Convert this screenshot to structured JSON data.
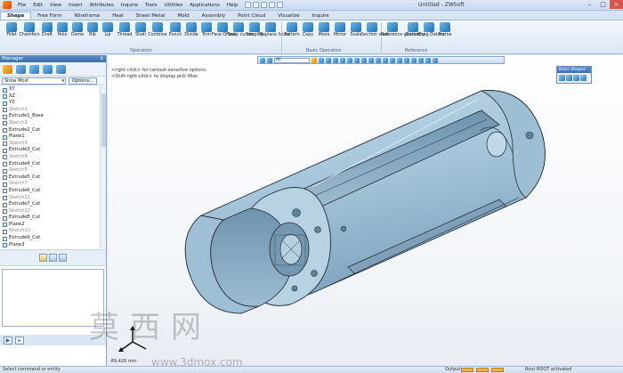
{
  "window": {
    "title": "Untitled - ZWSoft",
    "controls": {
      "minimize": "–",
      "maximize": "□",
      "close": "×"
    }
  },
  "menu": [
    "File",
    "Edit",
    "View",
    "Insert",
    "Attributes",
    "Inquire",
    "Tools",
    "Utilities",
    "Applications",
    "Help"
  ],
  "ribbon": {
    "tabs": [
      "Shape",
      "Free Form",
      "Wireframe",
      "Heal",
      "Sheet Metal",
      "Mold",
      "Assembly",
      "Point Cloud",
      "Visualize",
      "Inquire"
    ],
    "active_tab": "Shape",
    "buttons": [
      "Fillet",
      "Chamfers",
      "Draft",
      "Hole",
      "Dome",
      "Rib",
      "Lip",
      "Thread",
      "Shell",
      "Combine",
      "Punch",
      "Divide",
      "Trim",
      "Face Offset",
      "Snap curves",
      "Simplify",
      "Replace faces",
      "Pattern",
      "Copy",
      "Move",
      "Mirror",
      "Scale",
      "Section view",
      "Reference geometry",
      "Datum",
      "Drag Datum",
      "Frame"
    ],
    "groups": [
      "Operation",
      "Basic Operation",
      "Reference"
    ]
  },
  "manager": {
    "title": "Manager",
    "pin": "x",
    "filter": "Show Most",
    "options_label": "Options...",
    "tree": [
      {
        "label": "XY",
        "kind": "plane"
      },
      {
        "label": "XZ",
        "kind": "plane"
      },
      {
        "label": "YZ",
        "kind": "plane"
      },
      {
        "label": "Sketch1",
        "kind": "sketch"
      },
      {
        "label": "Extrude1_Base",
        "kind": "feature"
      },
      {
        "label": "Sketch2",
        "kind": "sketch"
      },
      {
        "label": "Extrude2_Cut",
        "kind": "feature"
      },
      {
        "label": "Plane1",
        "kind": "plane"
      },
      {
        "label": "Sketch3",
        "kind": "sketch"
      },
      {
        "label": "Extrude3_Cut",
        "kind": "feature"
      },
      {
        "label": "Sketch4",
        "kind": "sketch"
      },
      {
        "label": "Extrude4_Cut",
        "kind": "feature"
      },
      {
        "label": "Sketch5",
        "kind": "sketch"
      },
      {
        "label": "Extrude5_Cut",
        "kind": "feature"
      },
      {
        "label": "Sketch7",
        "kind": "sketch"
      },
      {
        "label": "Extrude6_Cut",
        "kind": "feature"
      },
      {
        "label": "Sketch11",
        "kind": "sketch"
      },
      {
        "label": "Extrude7_Cut",
        "kind": "feature"
      },
      {
        "label": "Sketch12",
        "kind": "sketch"
      },
      {
        "label": "Extrude8_Cut",
        "kind": "feature"
      },
      {
        "label": "Plane2",
        "kind": "plane"
      },
      {
        "label": "Sketch13",
        "kind": "sketch"
      },
      {
        "label": "Extrude9_Cut",
        "kind": "feature"
      },
      {
        "label": "Plane3",
        "kind": "plane"
      }
    ]
  },
  "viewport": {
    "hint_line1": "<right-click> for context-sensitive options.",
    "hint_line2": "<Shift-right-click> to display pick filter.",
    "filter_value": "All",
    "basic_shapes_title": "Basic Shapes",
    "coordinate": "-89,426 mm"
  },
  "statusbar": {
    "left": "Select command or entity",
    "output": "Output",
    "right": "Root ROOT activated"
  },
  "watermark": {
    "chars": "莫西网",
    "url": "www.3dmox.com"
  },
  "colors": {
    "part_fill": "#aac8dd",
    "part_edge": "#1f2a33",
    "ribbon_accent": "#1d6fb3"
  }
}
